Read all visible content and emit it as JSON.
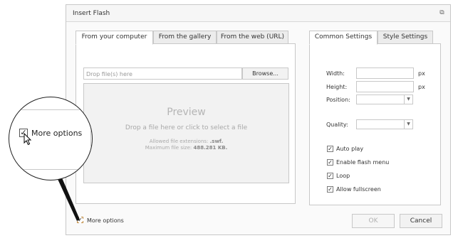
{
  "dialog": {
    "title": "Insert Flash",
    "close_icon": "close-icon"
  },
  "tabs_left": [
    {
      "label": "From your computer",
      "active": true
    },
    {
      "label": "From the gallery",
      "active": false
    },
    {
      "label": "From the web (URL)",
      "active": false
    }
  ],
  "upload": {
    "drop_placeholder": "Drop file(s) here",
    "browse_label": "Browse...",
    "preview_title": "Preview",
    "preview_desc": "Drop a file here or click to select a file",
    "allowed_label": "Allowed file extensions:",
    "allowed_value": ".swf.",
    "maxsize_label": "Maximum file size:",
    "maxsize_value": "488.281 KB."
  },
  "tabs_right": [
    {
      "label": "Common Settings",
      "active": true
    },
    {
      "label": "Style Settings",
      "active": false
    }
  ],
  "settings": {
    "width_label": "Width:",
    "width_value": "",
    "width_unit": "px",
    "height_label": "Height:",
    "height_value": "",
    "height_unit": "px",
    "position_label": "Position:",
    "position_value": "",
    "quality_label": "Quality:",
    "quality_value": "",
    "checkboxes": [
      {
        "label": "Auto play",
        "checked": true
      },
      {
        "label": "Enable flash menu",
        "checked": true
      },
      {
        "label": "Loop",
        "checked": true
      },
      {
        "label": "Allow fullscreen",
        "checked": true
      }
    ]
  },
  "footer": {
    "more_options_label": "More options",
    "more_options_checked": true,
    "ok_label": "OK",
    "cancel_label": "Cancel"
  },
  "magnifier": {
    "label": "More options"
  }
}
